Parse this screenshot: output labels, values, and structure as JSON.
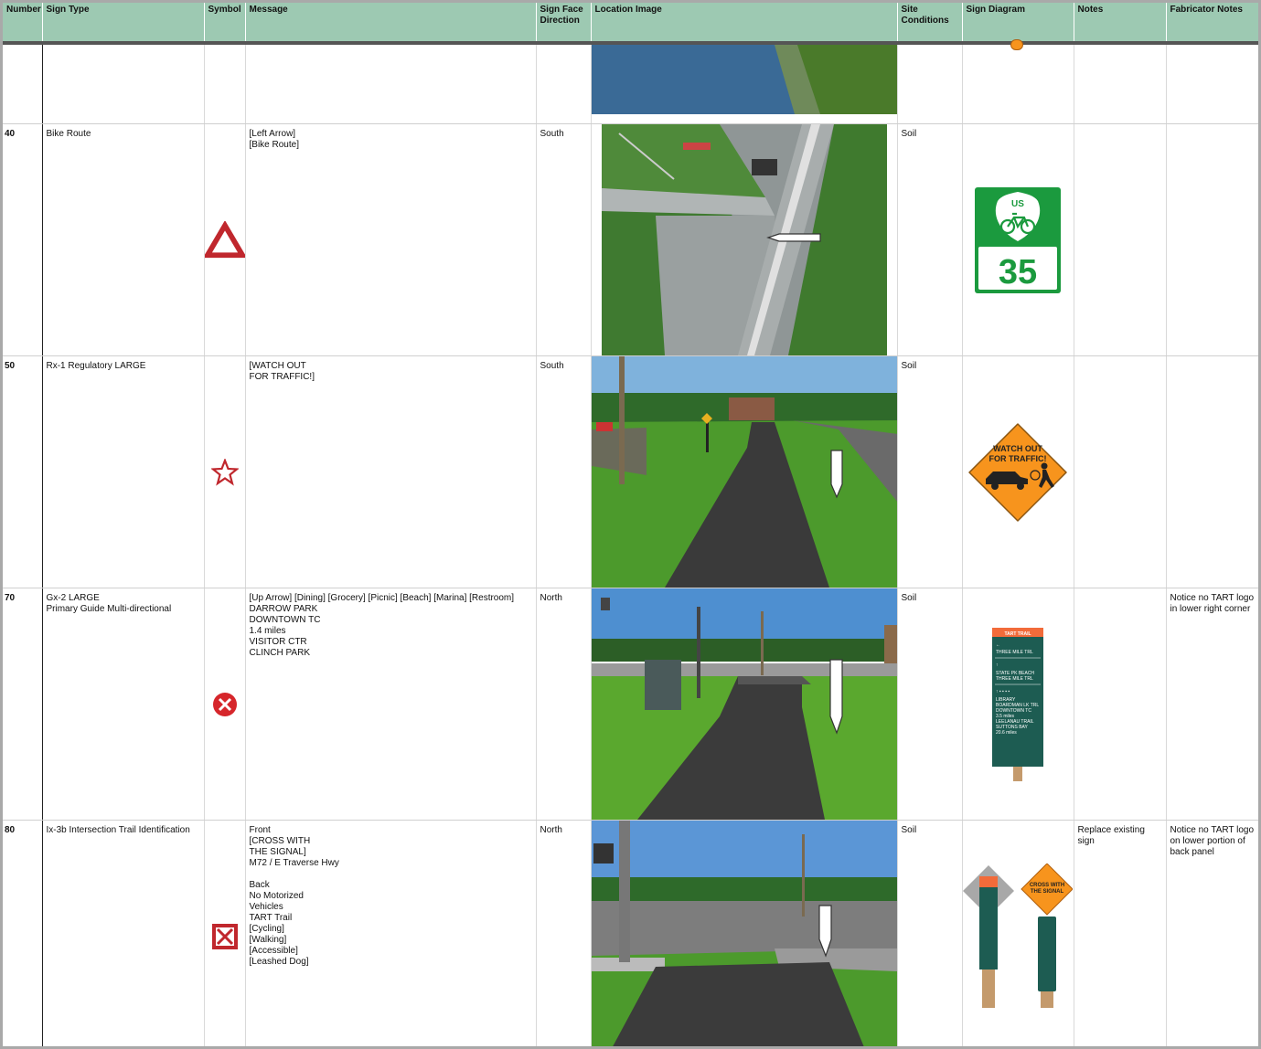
{
  "headers": [
    "Number",
    "Sign Type",
    "Symbol",
    "Message",
    "Sign Face Direction",
    "Location Image",
    "Site Conditions",
    "Sign Diagram",
    "Notes",
    "Fabricator Notes"
  ],
  "rows": [
    {
      "number": "",
      "sign_type": "",
      "symbol": "",
      "message": "",
      "direction": "",
      "conditions": "",
      "notes": "",
      "fab_notes": ""
    },
    {
      "number": "40",
      "sign_type": "Bike Route",
      "symbol": "triangle-icon",
      "message": "[Left Arrow]\n[Bike Route]",
      "direction": "South",
      "conditions": "Soil",
      "diagram": {
        "top": "US",
        "number": "35"
      },
      "notes": "",
      "fab_notes": ""
    },
    {
      "number": "50",
      "sign_type": "Rx-1 Regulatory LARGE",
      "symbol": "star-icon",
      "message": "[WATCH OUT\nFOR TRAFFIC!]",
      "direction": "South",
      "conditions": "Soil",
      "diagram": {
        "line1": "WATCH OUT",
        "line2": "FOR TRAFFIC!"
      },
      "notes": "",
      "fab_notes": ""
    },
    {
      "number": "70",
      "sign_type": "Gx-2 LARGE\nPrimary Guide Multi-directional",
      "symbol": "x-circle-icon",
      "message": "[Up Arrow] [Dining] [Grocery] [Picnic] [Beach] [Marina] [Restroom]\nDARROW PARK\nDOWNTOWN TC\n1.4 miles\nVISITOR CTR\nCLINCH PARK",
      "direction": "North",
      "conditions": "Soil",
      "diagram": {
        "header": "TART TRAIL",
        "l1": "THREE MILE TRL",
        "l2": "STATE PK BEACH",
        "l3": "THREE MILE TRL",
        "l4": "LIBRARY",
        "l5": "BOARDMAN LK TRL",
        "l6": "DOWNTOWN TC",
        "l7": "3.5 miles",
        "l8": "LEELANAU TRAIL",
        "l9": "SUTTONS BAY",
        "l10": "20.6 miles"
      },
      "notes": "",
      "fab_notes": "Notice no TART logo in lower right corner"
    },
    {
      "number": "80",
      "sign_type": "Ix-3b Intersection Trail Identification",
      "symbol": "x-square-icon",
      "message": "Front\n[CROSS WITH\nTHE SIGNAL]\nM72 / E Traverse Hwy\n\nBack\nNo Motorized\nVehicles\nTART Trail\n[Cycling]\n[Walking]\n[Accessible]\n[Leashed Dog]",
      "direction": "North",
      "conditions": "Soil",
      "diagram": {
        "line1": "CROSS WITH",
        "line2": "THE SIGNAL"
      },
      "notes": "Replace existing sign",
      "fab_notes": "Notice no TART logo on lower portion of back panel"
    }
  ],
  "colors": {
    "header_bg": "#9dc9b2",
    "symbol_red": "#c0272d",
    "sign_green": "#1b9a3e",
    "sign_orange": "#f7941d",
    "guide_teal": "#1d5c52"
  }
}
